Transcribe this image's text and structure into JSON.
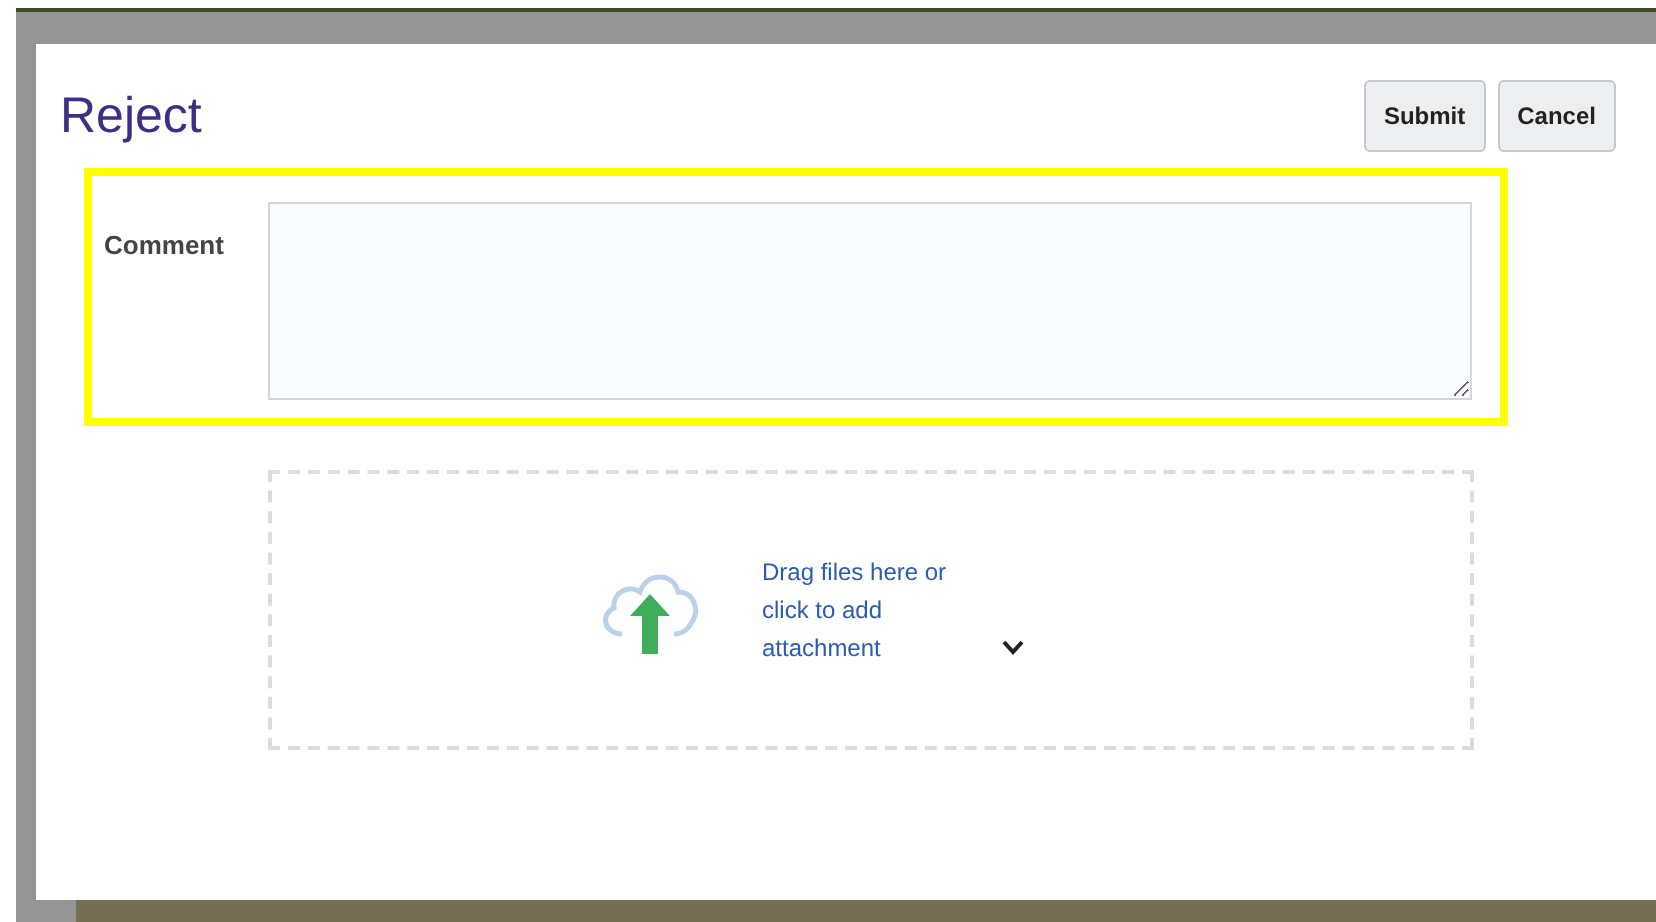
{
  "dialog": {
    "title": "Reject",
    "buttons": [
      {
        "label": "Submit"
      },
      {
        "label": "Cancel"
      }
    ]
  },
  "comment": {
    "label": "Comment",
    "highlighted": true
  },
  "attachment": {
    "text": "Drag files here or click to add attachment"
  }
}
